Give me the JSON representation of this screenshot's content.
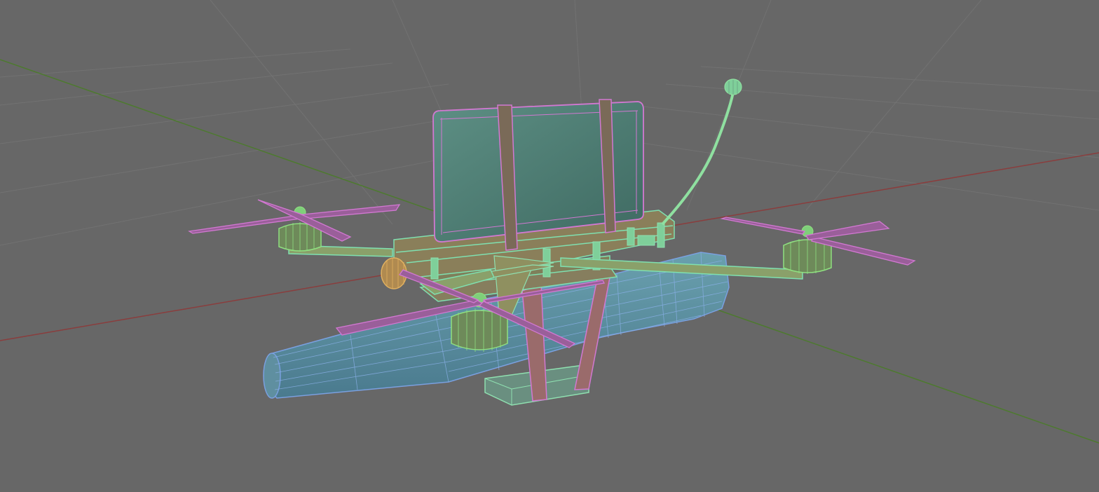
{
  "viewport": {
    "view": "perspective",
    "shading": "wireframe-over-solid",
    "background_color": "#676767",
    "grid": {
      "visible": true,
      "line_color": "#727272",
      "x_axis_color": "#8a3d3d",
      "y_axis_color": "#4d7a2e"
    }
  },
  "scene": {
    "object_kind": "fpv-drone-model",
    "parts": [
      {
        "name": "battery-box",
        "color": "#d278d2",
        "fill": "#4f7e74"
      },
      {
        "name": "battery-strap",
        "color": "#d278d2",
        "fill": "#7a6a58"
      },
      {
        "name": "frame-plate",
        "color": "#7fe0b0",
        "fill": "#7f7f5a"
      },
      {
        "name": "motor-arm",
        "color": "#7fe0b0",
        "fill": "#8aa06a"
      },
      {
        "name": "motor",
        "color": "#8fe080",
        "fill": "#6e8a5a"
      },
      {
        "name": "propeller",
        "color": "#d278d2",
        "fill": "#9a5f9a"
      },
      {
        "name": "antenna",
        "color": "#8fe0a0",
        "fill": "#7fcf9a"
      },
      {
        "name": "payload-tank",
        "color": "#7aa0e0",
        "fill": "#5f8fa0"
      },
      {
        "name": "mount-block",
        "color": "#8fe0b0",
        "fill": "#6a8f80"
      },
      {
        "name": "camera-lens",
        "color": "#e0b060",
        "fill": "#b08a50"
      }
    ]
  }
}
